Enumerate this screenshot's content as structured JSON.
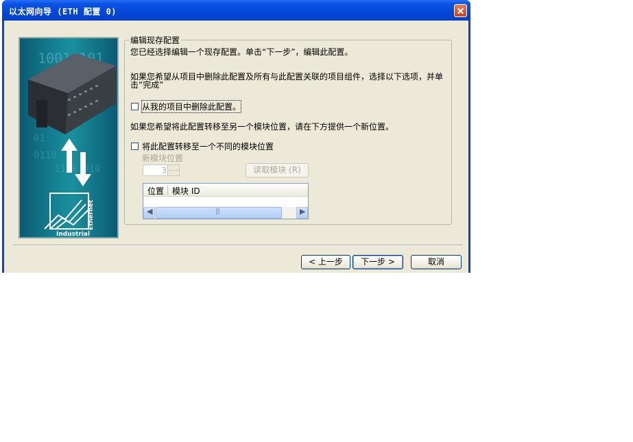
{
  "window": {
    "title": "以太网向导 (ETH 配置 0)",
    "close_label": "×"
  },
  "side_image": {
    "digits_text": "1001  101",
    "logo_industrial": "Industrial",
    "logo_ethernet": "Ethernet"
  },
  "group": {
    "legend": "编辑现存配置",
    "intro": "您已经选择编辑一个现存配置。单击“下一步”，编辑此配置。",
    "delete_hint_line1": "如果您希望从项目中删除此配置及所有与此配置关联的项目组件，选择以下选项，并单",
    "delete_hint_line2": "击“完成”",
    "delete_checkbox_label": "从我的项目中删除此配置。",
    "move_hint": "如果您希望将此配置转移至另一个模块位置，请在下方提供一个新位置。",
    "move_checkbox_label": "将此配置转移至一个不同的模块位置",
    "new_position_label": "新模块位置",
    "new_position_value": "3",
    "read_module_button": "读取模块 (R)",
    "table": {
      "columns": [
        "位置",
        "模块 ID"
      ],
      "rows": []
    }
  },
  "footer": {
    "back": "< 上一步",
    "next": "下一步 >",
    "cancel": "取消"
  },
  "colors": {
    "titlebar": "#0a54e6",
    "dialog_bg": "#ece9d8",
    "side_panel": "#178a9a"
  }
}
